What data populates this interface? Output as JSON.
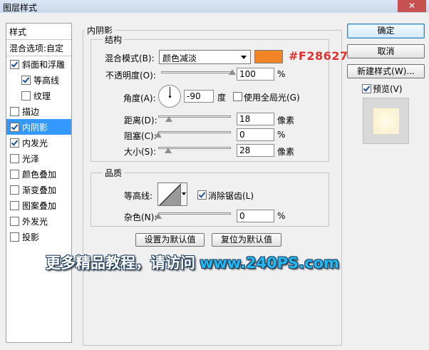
{
  "window": {
    "title": "图层样式",
    "close_glyph": "✕"
  },
  "left_panel": {
    "header": "样式",
    "blend_options": "混合选项:自定",
    "items": [
      {
        "label": "斜面和浮雕",
        "checked": true,
        "indent": false
      },
      {
        "label": "等高线",
        "checked": true,
        "indent": true
      },
      {
        "label": "纹理",
        "checked": false,
        "indent": true
      },
      {
        "label": "描边",
        "checked": false,
        "indent": false
      },
      {
        "label": "内阴影",
        "checked": true,
        "indent": false,
        "selected": true
      },
      {
        "label": "内发光",
        "checked": true,
        "indent": false
      },
      {
        "label": "光泽",
        "checked": false,
        "indent": false
      },
      {
        "label": "颜色叠加",
        "checked": false,
        "indent": false
      },
      {
        "label": "渐变叠加",
        "checked": false,
        "indent": false
      },
      {
        "label": "图案叠加",
        "checked": false,
        "indent": false
      },
      {
        "label": "外发光",
        "checked": false,
        "indent": false
      },
      {
        "label": "投影",
        "checked": false,
        "indent": false
      }
    ]
  },
  "inner_shadow": {
    "section_title": "内阴影",
    "structure": {
      "title": "结构",
      "blend_mode_label": "混合模式(B):",
      "blend_mode_value": "颜色减淡",
      "color": "#F28627",
      "color_label": "#F28627",
      "opacity_label": "不透明度(O):",
      "opacity_value": "100",
      "opacity_unit": "%",
      "opacity_fraction": 1.0,
      "angle_label": "角度(A):",
      "angle_value": "-90",
      "angle_unit": "度",
      "global_light_label": "使用全局光(G)",
      "global_light_checked": false,
      "distance_label": "距离(D):",
      "distance_value": "18",
      "distance_unit": "像素",
      "distance_fraction": 0.15,
      "choke_label": "阻塞(C):",
      "choke_value": "0",
      "choke_unit": "%",
      "choke_fraction": 0.0,
      "size_label": "大小(S):",
      "size_value": "28",
      "size_unit": "像素",
      "size_fraction": 0.14
    },
    "quality": {
      "title": "品质",
      "contour_label": "等高线:",
      "antialias_label": "消除锯齿(L)",
      "antialias_checked": true,
      "noise_label": "杂色(N):",
      "noise_value": "0",
      "noise_unit": "%",
      "noise_fraction": 0.0
    },
    "make_default": "设置为默认值",
    "reset_default": "复位为默认值"
  },
  "right": {
    "ok": "确定",
    "cancel": "取消",
    "new_style": "新建样式(W)...",
    "preview_label": "预览(V)",
    "preview_checked": true
  },
  "watermark": {
    "text": "更多精品教程，请访问",
    "url": "www.240PS.com"
  }
}
